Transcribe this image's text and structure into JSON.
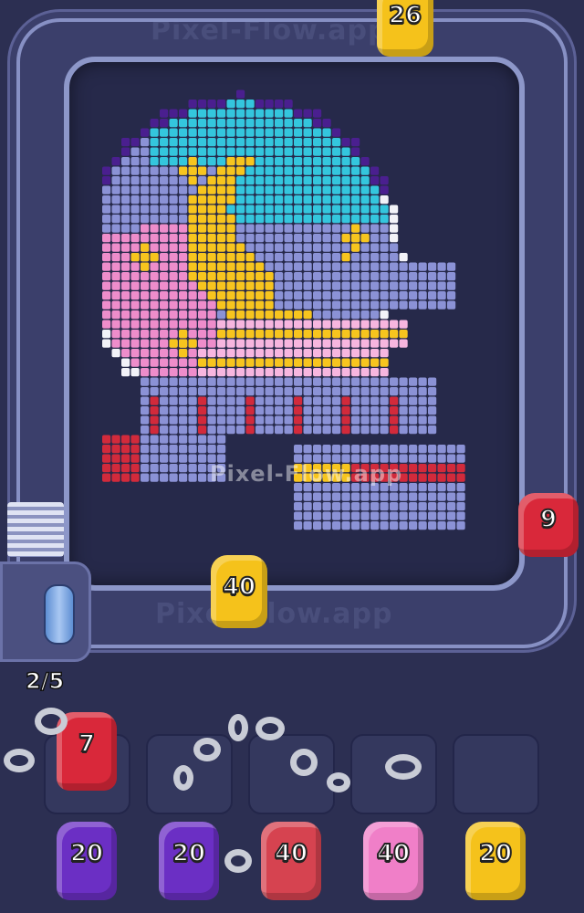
{
  "watermark": {
    "text": "Pixel-Flow.app",
    "mid_text": "Pixel-Flow.app"
  },
  "counter": {
    "value": "2/5"
  },
  "conveyor_units": [
    {
      "count": "26",
      "color": "#f5c21b"
    },
    {
      "count": "9",
      "color": "#d9283a"
    },
    {
      "count": "40",
      "color": "#f5c21b"
    }
  ],
  "holding_slots": [
    {
      "count": "7",
      "color": "#d9283a"
    },
    {
      "count": "",
      "color": ""
    },
    {
      "count": "",
      "color": ""
    },
    {
      "count": "",
      "color": ""
    },
    {
      "count": "",
      "color": ""
    }
  ],
  "queue": [
    {
      "count": "20",
      "color": "#6b2fc4"
    },
    {
      "count": "20",
      "color": "#6b2fc4"
    },
    {
      "count": "40",
      "color": "#d64350"
    },
    {
      "count": "40",
      "color": "#f07fc8"
    },
    {
      "count": "20",
      "color": "#f5c21b"
    }
  ],
  "palette": {
    "cyan": "#34c6dd",
    "lavender": "#8b92d6",
    "pink": "#ee8dcb",
    "yellow": "#f7c51e",
    "red": "#d22a3b",
    "dark_purple": "#4a1f8f",
    "white": "#f2f2f8",
    "light_pink": "#f7b6df"
  }
}
